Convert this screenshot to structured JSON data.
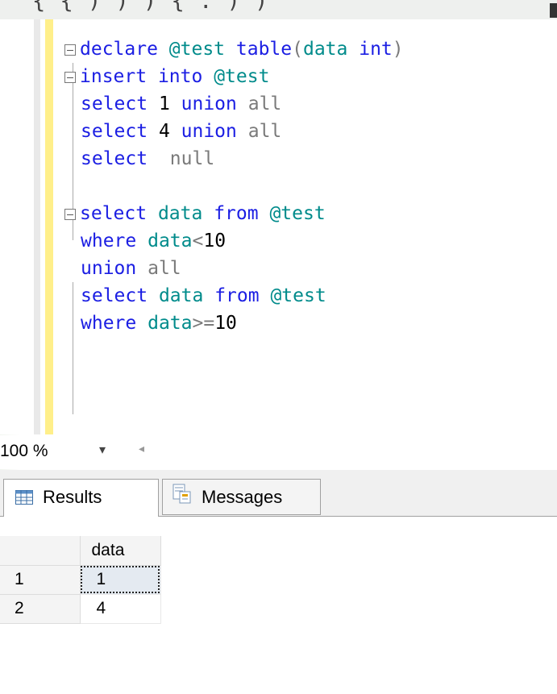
{
  "top_fragment": "{ { ) ) ) { : ) )",
  "editor": {
    "lines": [
      {
        "collapse": true,
        "tokens": [
          {
            "t": "declare ",
            "c": "kw"
          },
          {
            "t": "@test ",
            "c": "teal"
          },
          {
            "t": "table",
            "c": "kw"
          },
          {
            "t": "(",
            "c": "gray"
          },
          {
            "t": "data ",
            "c": "teal"
          },
          {
            "t": "int",
            "c": "kw"
          },
          {
            "t": ")",
            "c": "gray"
          }
        ]
      },
      {
        "collapse": true,
        "tokens": [
          {
            "t": "insert ",
            "c": "kw"
          },
          {
            "t": "into ",
            "c": "kw"
          },
          {
            "t": "@test",
            "c": "teal"
          }
        ]
      },
      {
        "collapse": false,
        "tokens": [
          {
            "t": "select ",
            "c": "kw"
          },
          {
            "t": "1 ",
            "c": "black"
          },
          {
            "t": "union ",
            "c": "kw"
          },
          {
            "t": "all",
            "c": "gray"
          }
        ]
      },
      {
        "collapse": false,
        "tokens": [
          {
            "t": "select ",
            "c": "kw"
          },
          {
            "t": "4 ",
            "c": "black"
          },
          {
            "t": "union ",
            "c": "kw"
          },
          {
            "t": "all",
            "c": "gray"
          }
        ]
      },
      {
        "collapse": false,
        "tokens": [
          {
            "t": "select  ",
            "c": "kw"
          },
          {
            "t": "null",
            "c": "gray"
          }
        ]
      },
      {
        "collapse": false,
        "tokens": []
      },
      {
        "collapse": true,
        "tokens": [
          {
            "t": "select ",
            "c": "kw"
          },
          {
            "t": "data ",
            "c": "teal"
          },
          {
            "t": "from ",
            "c": "kw"
          },
          {
            "t": "@test",
            "c": "teal"
          }
        ]
      },
      {
        "collapse": false,
        "tokens": [
          {
            "t": "where ",
            "c": "kw"
          },
          {
            "t": "data",
            "c": "teal"
          },
          {
            "t": "<",
            "c": "gray"
          },
          {
            "t": "10",
            "c": "black"
          }
        ]
      },
      {
        "collapse": false,
        "tokens": [
          {
            "t": "union ",
            "c": "kw"
          },
          {
            "t": "all",
            "c": "gray"
          }
        ]
      },
      {
        "collapse": false,
        "tokens": [
          {
            "t": "select ",
            "c": "kw"
          },
          {
            "t": "data ",
            "c": "teal"
          },
          {
            "t": "from ",
            "c": "kw"
          },
          {
            "t": "@test",
            "c": "teal"
          }
        ]
      },
      {
        "collapse": false,
        "tokens": [
          {
            "t": "where ",
            "c": "kw"
          },
          {
            "t": "data",
            "c": "teal"
          },
          {
            "t": ">=",
            "c": "gray"
          },
          {
            "t": "10",
            "c": "black"
          }
        ]
      }
    ]
  },
  "zoom": {
    "value": "100 %"
  },
  "tabs": {
    "results": "Results",
    "messages": "Messages"
  },
  "results": {
    "column": "data",
    "rows": [
      {
        "num": "1",
        "value": "1"
      },
      {
        "num": "2",
        "value": "4"
      }
    ]
  },
  "colors": {
    "keyword": "#1b1ee3",
    "identifier": "#008b8b",
    "operator": "#7a7a7a",
    "margin_yellow": "#ffef8a"
  }
}
